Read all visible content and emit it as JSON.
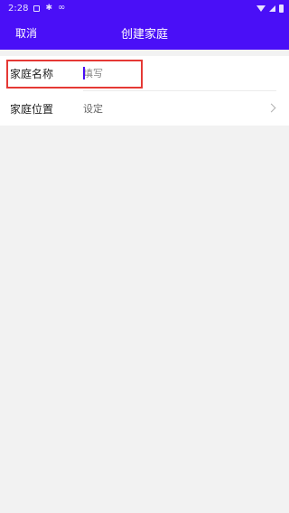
{
  "status_bar": {
    "time": "2:28",
    "icons": [
      "sim-icon",
      "gear-icon",
      "infinity-icon",
      "wifi-icon",
      "signal-icon",
      "battery-icon"
    ]
  },
  "header": {
    "cancel_label": "取消",
    "title": "创建家庭",
    "background_color": "#4a0ff7"
  },
  "form": {
    "name_row": {
      "label": "家庭名称",
      "placeholder": "填写",
      "value": ""
    },
    "location_row": {
      "label": "家庭位置",
      "value": "设定"
    }
  }
}
